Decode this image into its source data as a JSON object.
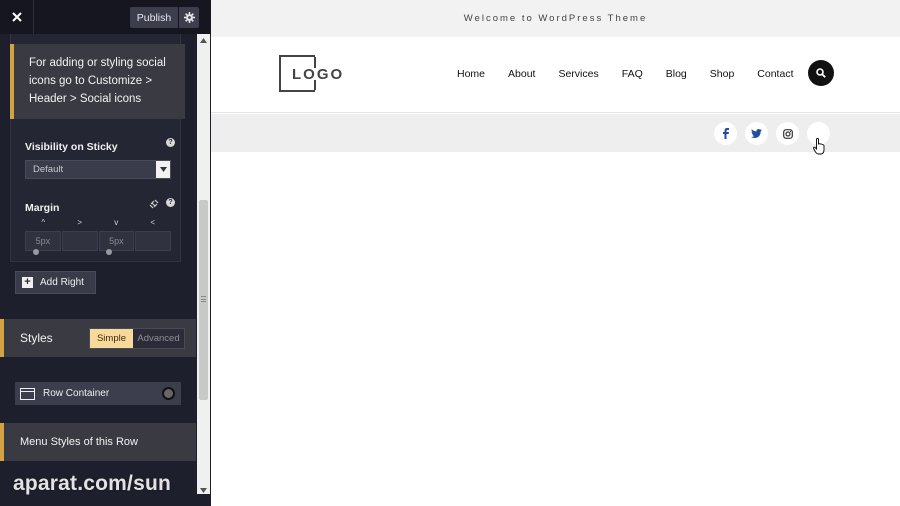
{
  "topbar": {
    "close_icon": "close-icon",
    "publish_label": "Publish",
    "settings_icon": "gear-icon"
  },
  "panel": {
    "info_text": "For adding or styling social icons go to Customize > Header > Social icons",
    "visibility_label": "Visibility on Sticky",
    "visibility_value": "Default",
    "margin_label": "Margin",
    "margin_directions": [
      "^",
      ">",
      "v",
      "<"
    ],
    "margin_values": [
      "5px",
      "",
      "5px",
      ""
    ],
    "add_right_label": "Add Right"
  },
  "styles": {
    "title": "Styles",
    "simple_label": "Simple",
    "advanced_label": "Advanced",
    "active": "Simple"
  },
  "row_container_label": "Row Container",
  "menu_styles_title": "Menu Styles of this Row",
  "watermark": "aparat.com/sun",
  "preview": {
    "welcome": "Welcome to WordPress Theme",
    "logo_text": "LOGO",
    "nav": [
      "Home",
      "About",
      "Services",
      "FAQ",
      "Blog",
      "Shop",
      "Contact"
    ],
    "social_icons": [
      "facebook-icon",
      "twitter-icon",
      "instagram-icon",
      "blank-icon"
    ],
    "colors": {
      "accent": "#d3a244",
      "sidebar_bg": "#1e1f2c",
      "social_icon": "#1f4e9c"
    }
  }
}
